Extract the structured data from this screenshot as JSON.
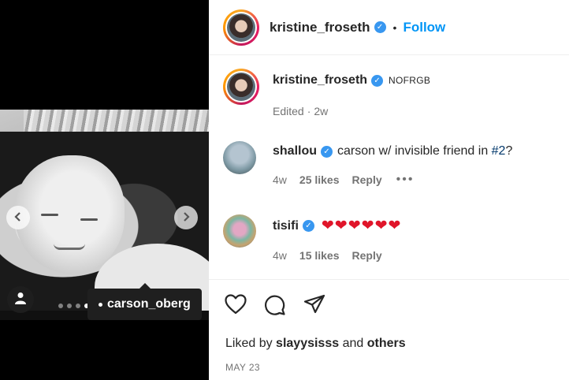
{
  "post": {
    "author": "kristine_froseth",
    "follow_label": "Follow",
    "separator": "•",
    "tagged_user": "carson_oberg",
    "carousel_dots": 5,
    "active_dot": 4
  },
  "caption": {
    "username": "kristine_froseth",
    "text": "NOFRGB",
    "edited_label": "Edited",
    "time_sep": "·",
    "time": "2w"
  },
  "comments": [
    {
      "username": "shallou",
      "text": "carson w/ invisible friend in ",
      "hashtag": "#2",
      "text_after": "?",
      "time": "4w",
      "likes": "25 likes",
      "reply": "Reply",
      "more": "•••"
    },
    {
      "username": "tisifi",
      "text": "❤❤❤❤❤❤",
      "time": "4w",
      "likes": "15 likes",
      "reply": "Reply"
    }
  ],
  "footer": {
    "liked_by_prefix": "Liked by ",
    "liked_by_user": "slayysisss",
    "liked_by_and": " and ",
    "liked_by_others": "others",
    "date": "MAY 23"
  },
  "icons": {
    "like": "heart-icon",
    "comment": "comment-icon",
    "share": "share-icon",
    "user_tag": "user-icon",
    "verified": "verified-badge-icon",
    "prev": "chevron-left-icon",
    "next": "chevron-right-icon"
  },
  "colors": {
    "accent": "#0095f6",
    "verified": "#3897f0",
    "heart": "#e0152a",
    "muted": "#737373"
  }
}
